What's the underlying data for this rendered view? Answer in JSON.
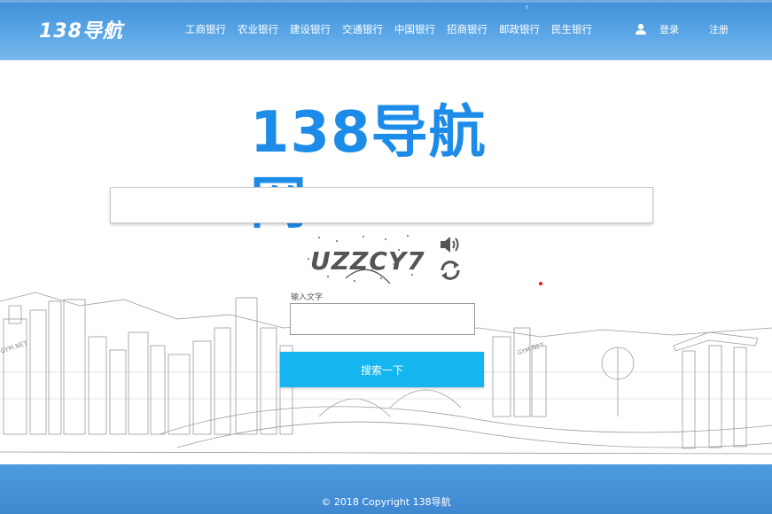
{
  "header": {
    "logo": "138导航",
    "nav": [
      "工商银行",
      "农业银行",
      "建设银行",
      "交通银行",
      "中国银行",
      "招商银行",
      "邮政银行",
      "民生银行"
    ],
    "login_label": "登录",
    "register_label": "注册",
    "tiny_mark": "ⲧ"
  },
  "main": {
    "logo": "138导航网",
    "url_input_value": "",
    "captcha_text": "UZZCY7",
    "input_label": "输入文字",
    "code_input_value": "",
    "search_button": "搜索一下",
    "watermark_left": "GYM.NET",
    "watermark_right": "GYM.NET"
  },
  "footer": {
    "copyright": "© 2018 Copyright 138导航"
  },
  "colors": {
    "accent": "#1d8ce8",
    "button": "#15b5f0",
    "header": "#3f8fd8"
  }
}
